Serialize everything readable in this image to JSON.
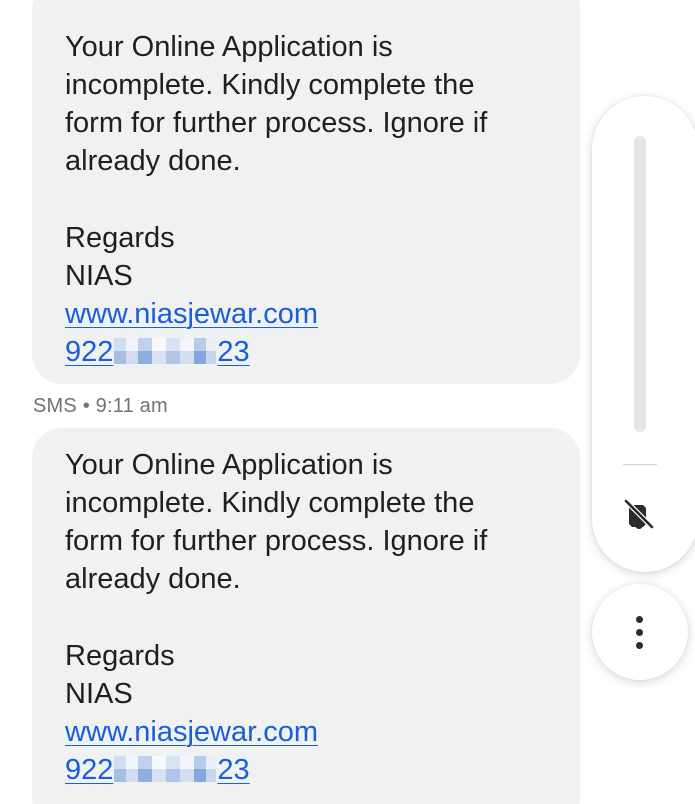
{
  "messages": [
    {
      "lines": [
        "Your Online Application is",
        "incomplete. Kindly complete the",
        "form for further process. Ignore if",
        "already done."
      ],
      "regards": "Regards",
      "sender_name": "NIAS",
      "link": "www.niasjewar.com",
      "phone_prefix": "922",
      "phone_suffix": "23"
    },
    {
      "lines": [
        "Your Online Application is",
        "incomplete. Kindly complete the",
        "form for further process. Ignore if",
        "already done."
      ],
      "regards": "Regards",
      "sender_name": "NIAS",
      "link": "www.niasjewar.com",
      "phone_prefix": "922",
      "phone_suffix": "23"
    }
  ],
  "meta": {
    "text": "SMS • 9:11 am"
  },
  "volume_panel": {
    "mute_icon": "volume-off-icon",
    "more_icon": "more-vertical-icon"
  },
  "colors": {
    "bubble": "#f0f1f2",
    "link": "#1a5fd6",
    "meta_text": "#6f7276"
  }
}
